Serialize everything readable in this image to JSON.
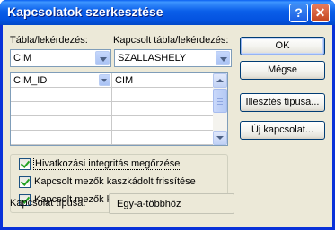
{
  "window": {
    "title": "Kapcsolatok szerkesztése"
  },
  "titlebar": {
    "help_glyph": "?",
    "close_glyph": "✕"
  },
  "labels": {
    "table_query": "Tábla/lekérdezés:",
    "related_table_query": "Kapcsolt tábla/lekérdezés:",
    "relationship_type": "Kapcsolat típusa:"
  },
  "combos": {
    "table": "CIM",
    "related_table": "SZALLASHELY"
  },
  "field_grid": {
    "rows": [
      {
        "left": "CIM_ID",
        "right": "CIM"
      },
      {
        "left": "",
        "right": ""
      },
      {
        "left": "",
        "right": ""
      },
      {
        "left": "",
        "right": ""
      },
      {
        "left": "",
        "right": ""
      }
    ]
  },
  "options": [
    {
      "label": "Hivatkozási integritás megőrzése",
      "checked": true
    },
    {
      "label": "Kapcsolt mezők kaszkádolt frissítése",
      "checked": true
    },
    {
      "label": "Kapcsolt mezők kaszkádolt törlése",
      "checked": true
    }
  ],
  "relationship_type_value": "Egy-a-többhöz",
  "buttons": {
    "ok": "OK",
    "cancel": "Mégse",
    "join_type": "Illesztés típusa...",
    "new_relationship": "Új kapcsolat..."
  },
  "colors": {
    "titlebar": "#0453e0",
    "dialog_bg": "#ece9d8",
    "check_mark": "#21a121"
  }
}
